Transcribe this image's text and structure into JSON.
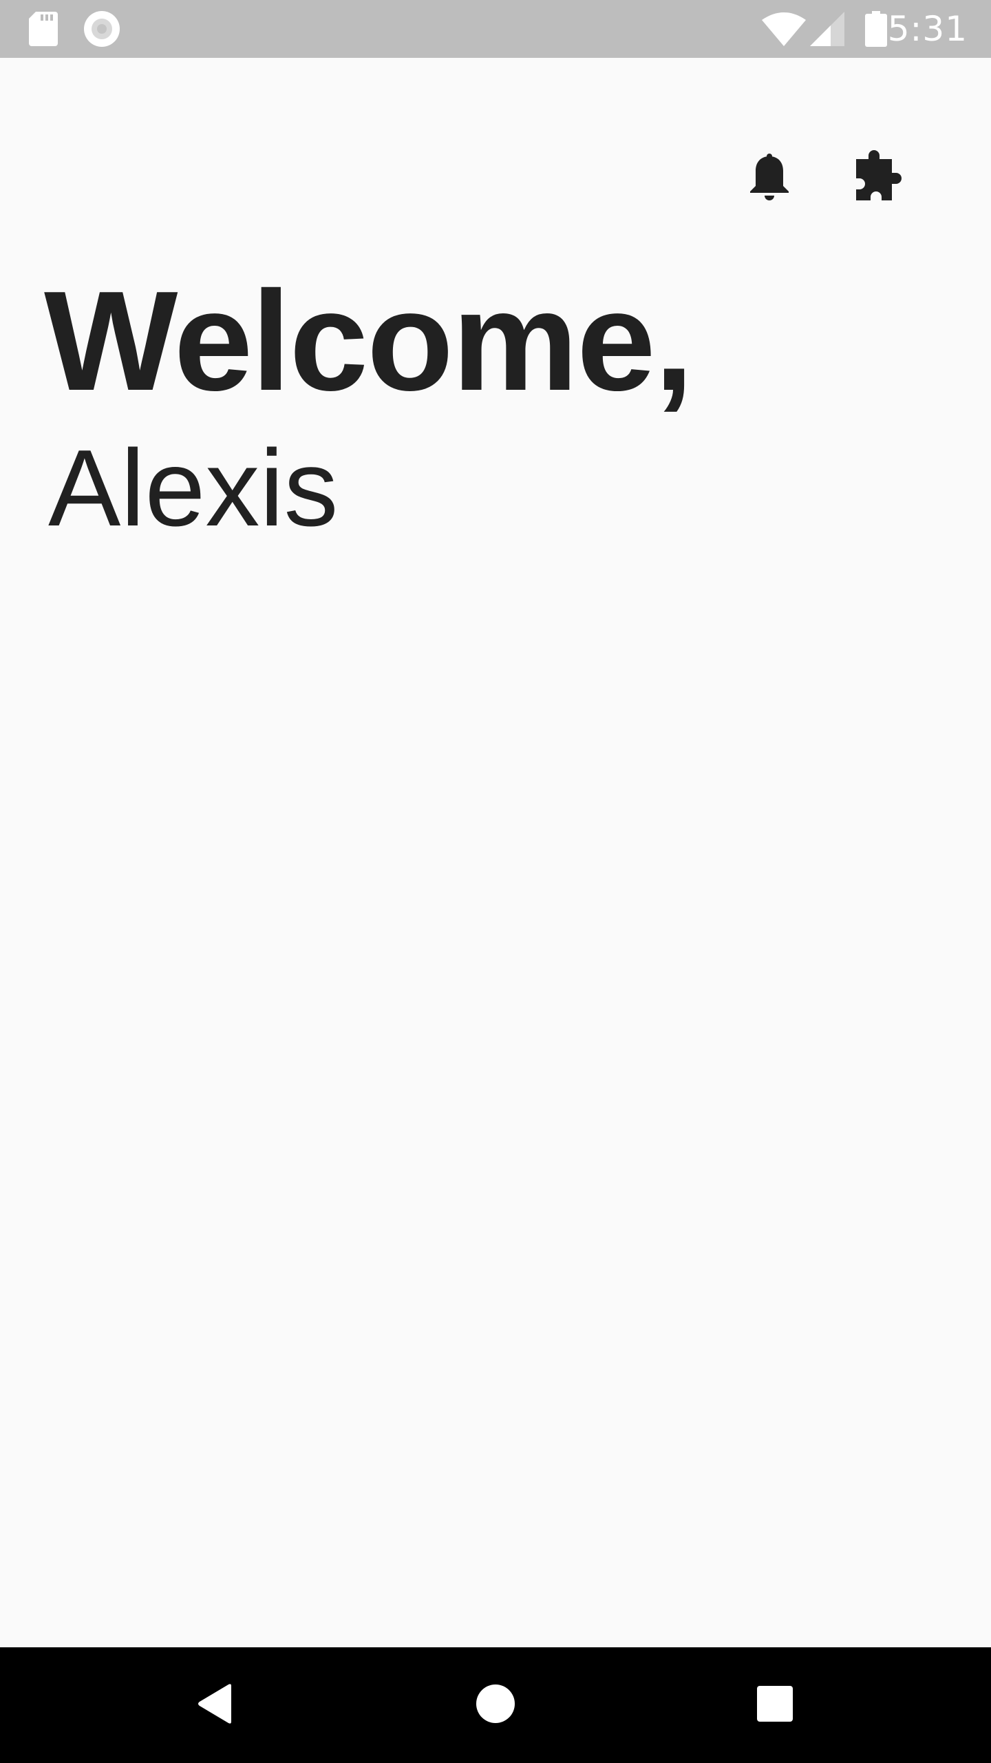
{
  "status_bar": {
    "time": "5:31",
    "left_icons": [
      "sd-card-icon",
      "sync-circle-icon"
    ],
    "right_icons": [
      "wifi-icon",
      "cell-signal-icon",
      "battery-icon"
    ],
    "background": "#bdbdbd",
    "icon_color": "#ffffff"
  },
  "app_bar": {
    "actions": [
      {
        "name": "notifications-button",
        "icon": "bell-icon"
      },
      {
        "name": "extensions-button",
        "icon": "puzzle-piece-icon"
      }
    ]
  },
  "main": {
    "greeting": "Welcome,",
    "user_name": "Alexis",
    "text_color": "#212121",
    "background": "#fafafa"
  },
  "nav_bar": {
    "buttons": [
      {
        "name": "back-button",
        "icon": "back-triangle-icon"
      },
      {
        "name": "home-button",
        "icon": "home-circle-icon"
      },
      {
        "name": "recents-button",
        "icon": "recents-square-icon"
      }
    ],
    "background": "#000000",
    "icon_color": "#ffffff"
  }
}
